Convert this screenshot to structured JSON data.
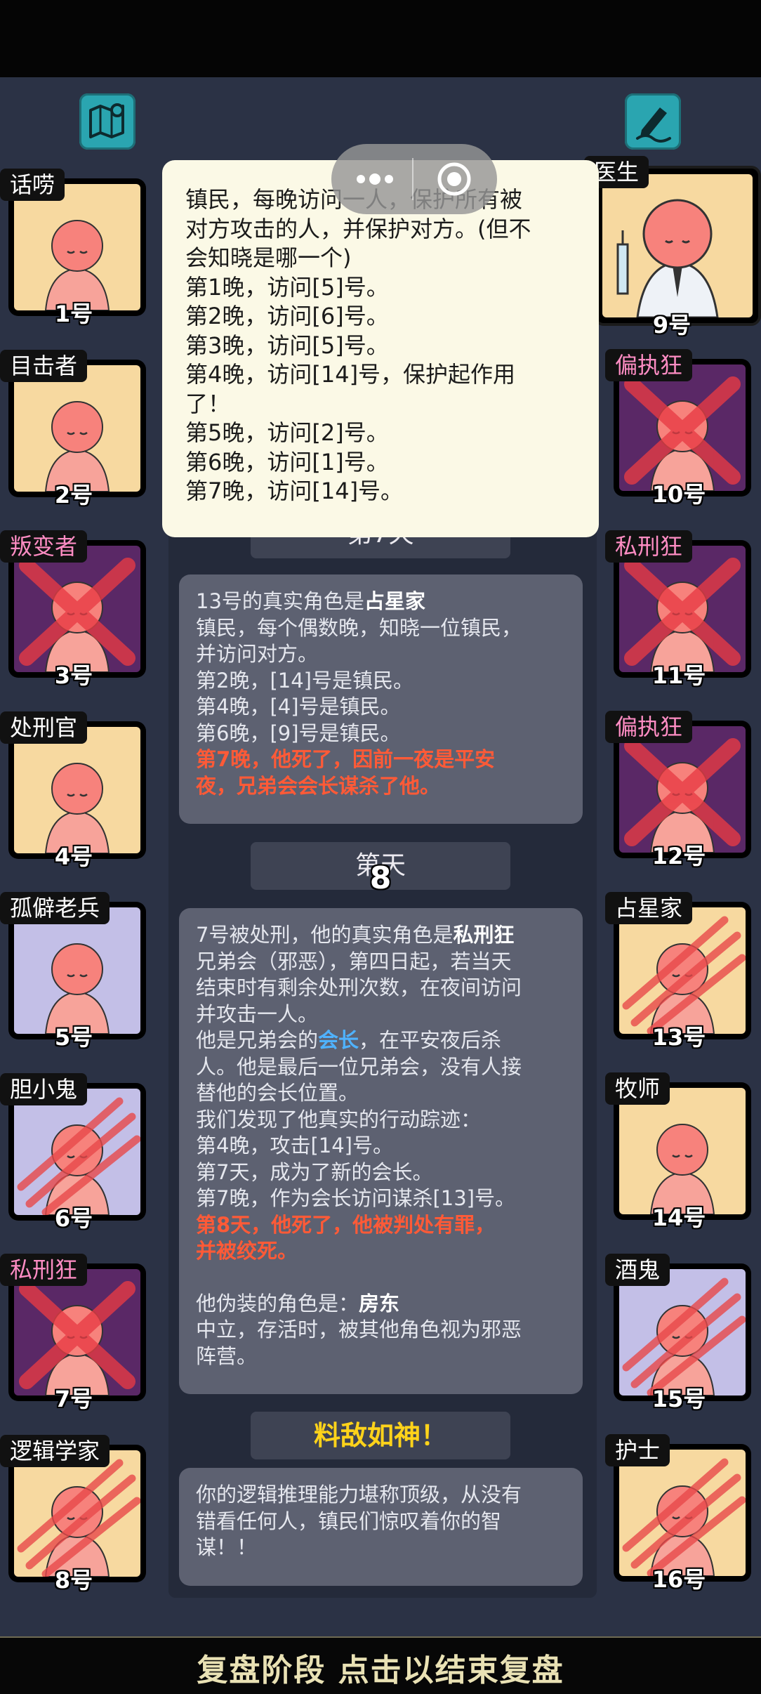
{
  "top_buttons": {
    "left_icon": "map-pin-icon",
    "right_icon": "pencil-note-icon"
  },
  "popup": {
    "lines": [
      "镇民，每晚访问一人，保护所有被",
      "对方攻击的人，并保护对方。(但不",
      "会知晓是哪一个)",
      "第1晚，访问[5]号。",
      "第2晚，访问[6]号。",
      "第3晚，访问[5]号。",
      "第4晚，访问[14]号，保护起作用",
      "了！",
      "第5晚，访问[2]号。",
      "第6晚，访问[1]号。",
      "第7晚，访问[14]号。"
    ]
  },
  "log": {
    "hidden_header": "第7天",
    "card1": {
      "lead": "13号的真实角色是",
      "role": "占星家",
      "lines": [
        "镇民，每个偶数晚，知晓一位镇民，",
        "并访问对方。",
        "第2晚，[14]号是镇民。",
        "第4晚，[4]号是镇民。",
        "第6晚，[9]号是镇民。"
      ],
      "death": [
        "第7晚，他死了，因前一夜是平安",
        "夜，兄弟会会长谋杀了他。"
      ]
    },
    "day8": {
      "prefix": "第",
      "number": "8",
      "suffix": "天"
    },
    "card2": {
      "lead": "7号被处刑，他的真实角色是",
      "role": "私刑狂",
      "line_a": [
        "兄弟会（邪恶），第四日起，若当天",
        "结束时有剩余处刑次数，在夜间访问",
        "并攻击一人。"
      ],
      "line_b_pre": "他是兄弟会的",
      "line_b_hl": "会长",
      "line_b_post": "，在平安夜后杀",
      "line_c": [
        "人。他是最后一位兄弟会，没有人接",
        "替他的会长位置。",
        "我们发现了他真实的行动踪迹：",
        "第4晚，攻击[14]号。",
        "第7天，成为了新的会长。",
        "第7晚，作为会长访问谋杀[13]号。"
      ],
      "death": [
        "第8天，他死了，他被判处有罪，",
        "并被绞死。"
      ],
      "disguise_lead": "他伪装的角色是：",
      "disguise_role": "房东",
      "disguise_lines": [
        "中立，存活时，被其他角色视为邪恶",
        "阵营。"
      ]
    },
    "verdict": "料敌如神！",
    "card3": [
      "你的逻辑推理能力堪称顶级，从没有",
      "错看任何人，镇民们惊叹着你的智",
      "谋！！"
    ]
  },
  "players_left": [
    {
      "role": "话唠",
      "num": "1号",
      "bg": "#f7d9a0",
      "evil": false,
      "mark": "none"
    },
    {
      "role": "目击者",
      "num": "2号",
      "bg": "#f7d9a0",
      "evil": false,
      "mark": "none"
    },
    {
      "role": "叛变者",
      "num": "3号",
      "bg": "#5a2866",
      "evil": true,
      "mark": "cross"
    },
    {
      "role": "处刑官",
      "num": "4号",
      "bg": "#f7d9a0",
      "evil": false,
      "mark": "none"
    },
    {
      "role": "孤僻老兵",
      "num": "5号",
      "bg": "#c3bfe7",
      "evil": false,
      "mark": "none"
    },
    {
      "role": "胆小鬼",
      "num": "6号",
      "bg": "#c3bfe7",
      "evil": false,
      "mark": "claw"
    },
    {
      "role": "私刑狂",
      "num": "7号",
      "bg": "#5a2866",
      "evil": true,
      "mark": "cross"
    },
    {
      "role": "逻辑学家",
      "num": "8号",
      "bg": "#f7d9a0",
      "evil": false,
      "mark": "claw"
    }
  ],
  "players_right": [
    {
      "role": "偏执狂",
      "num": "10号",
      "bg": "#5a2866",
      "evil": true,
      "mark": "cross"
    },
    {
      "role": "私刑狂",
      "num": "11号",
      "bg": "#5a2866",
      "evil": true,
      "mark": "cross"
    },
    {
      "role": "偏执狂",
      "num": "12号",
      "bg": "#5a2866",
      "evil": true,
      "mark": "cross"
    },
    {
      "role": "占星家",
      "num": "13号",
      "bg": "#f7d9a0",
      "evil": false,
      "mark": "claw"
    },
    {
      "role": "牧师",
      "num": "14号",
      "bg": "#f7d9a0",
      "evil": false,
      "mark": "none"
    },
    {
      "role": "酒鬼",
      "num": "15号",
      "bg": "#c3bfe7",
      "evil": false,
      "mark": "claw"
    },
    {
      "role": "护士",
      "num": "16号",
      "bg": "#f7d9a0",
      "evil": false,
      "mark": "claw"
    }
  ],
  "doctor": {
    "role": "医生",
    "num": "9号"
  },
  "bottom": {
    "label": "复盘阶段 点击以结束复盘"
  }
}
